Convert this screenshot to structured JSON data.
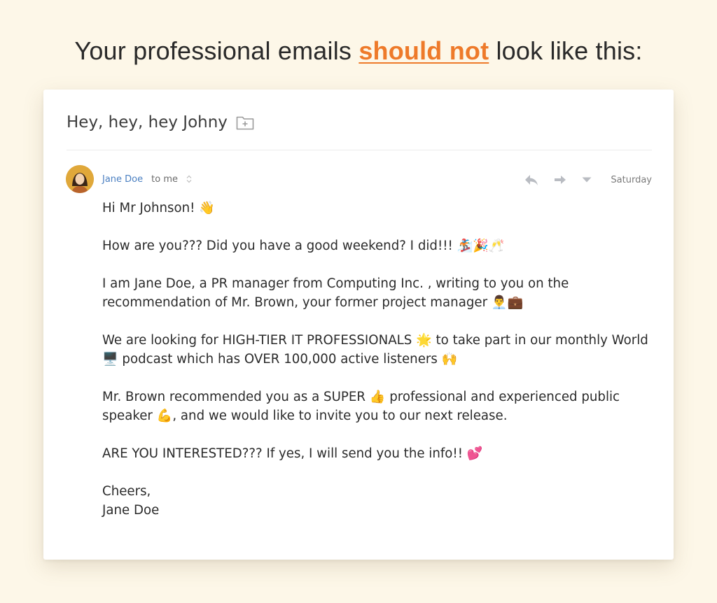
{
  "headline": {
    "prefix": "Your professional emails ",
    "accent": "should not",
    "suffix": " look like this:"
  },
  "email": {
    "subject": "Hey, hey, hey Johny",
    "sender_name": "Jane Doe",
    "recipient": "to me",
    "date": "Saturday",
    "icons": {
      "move": "folder-plus-icon",
      "reply": "reply-icon",
      "forward": "forward-icon",
      "more": "caret-down-icon",
      "sort": "sort-updown-icon"
    },
    "paragraphs": [
      "Hi Mr Johnson! 👋",
      "How are you??? Did you have a good weekend? I did!!! 🏂🎉🥂",
      "I am Jane Doe, a PR manager from Computing Inc. , writing to you on the recommendation of Mr. Brown, your former project manager 👨‍💼💼",
      "We are looking for HIGH-TIER IT PROFESSIONALS 🌟 to take part in our monthly World 🖥️ podcast which has OVER 100,000 active listeners 🙌",
      "Mr. Brown recommended you as a SUPER 👍 professional and experienced public speaker 💪, and we would like to invite you to our next release.",
      "ARE YOU INTERESTED??? If yes, I will send you the info!! 💕"
    ],
    "signoff_1": "Cheers,",
    "signoff_2": "Jane Doe"
  },
  "colors": {
    "background": "#fdf7e8",
    "accent": "#ee7a2a",
    "link": "#4a7fc1"
  }
}
